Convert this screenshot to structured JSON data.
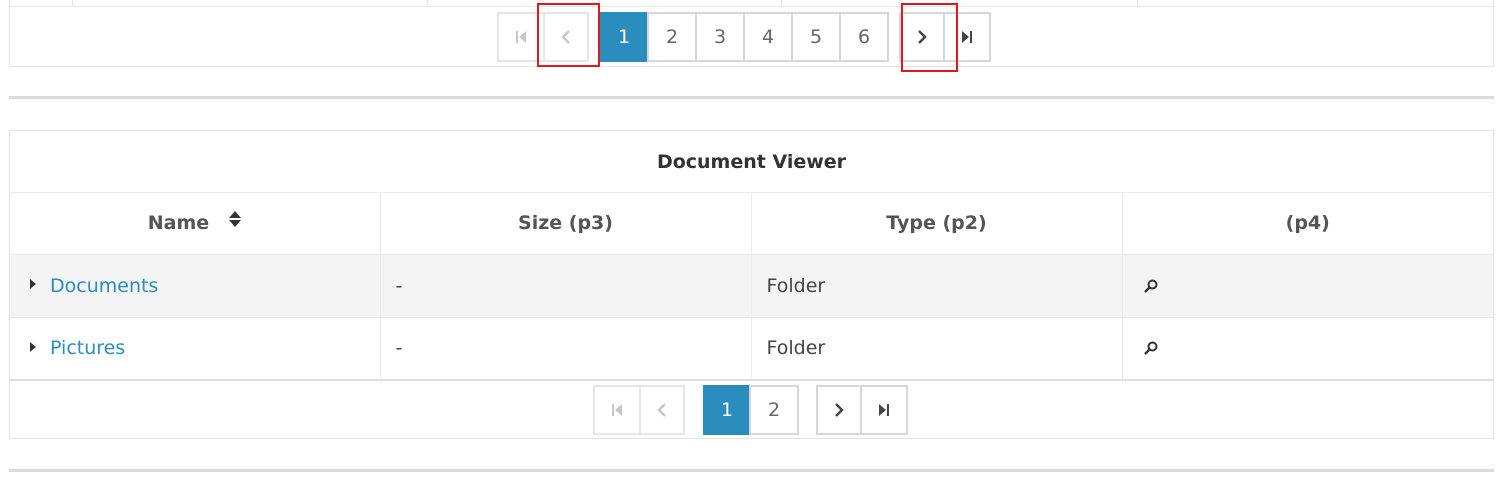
{
  "top_pager": {
    "first_icon": "first-page-icon",
    "prev_icon": "chevron-left-icon",
    "pages": [
      "1",
      "2",
      "3",
      "4",
      "5",
      "6"
    ],
    "active_page": "1",
    "next_icon": "chevron-right-icon",
    "last_icon": "last-page-icon"
  },
  "viewer": {
    "title": "Document Viewer",
    "columns": [
      "Name",
      "Size (p3)",
      "Type (p2)",
      "(p4)"
    ],
    "rows": [
      {
        "name": "Documents",
        "size": "-",
        "type": "Folder",
        "action_icon": "search-icon"
      },
      {
        "name": "Pictures",
        "size": "-",
        "type": "Folder",
        "action_icon": "search-icon"
      }
    ],
    "sort_icon": "sort-icon",
    "expand_icon": "caret-right-icon"
  },
  "bottom_pager": {
    "pages": [
      "1",
      "2"
    ],
    "active_page": "1"
  },
  "colors": {
    "accent": "#2b8dbe",
    "highlight": "#e0191f"
  }
}
